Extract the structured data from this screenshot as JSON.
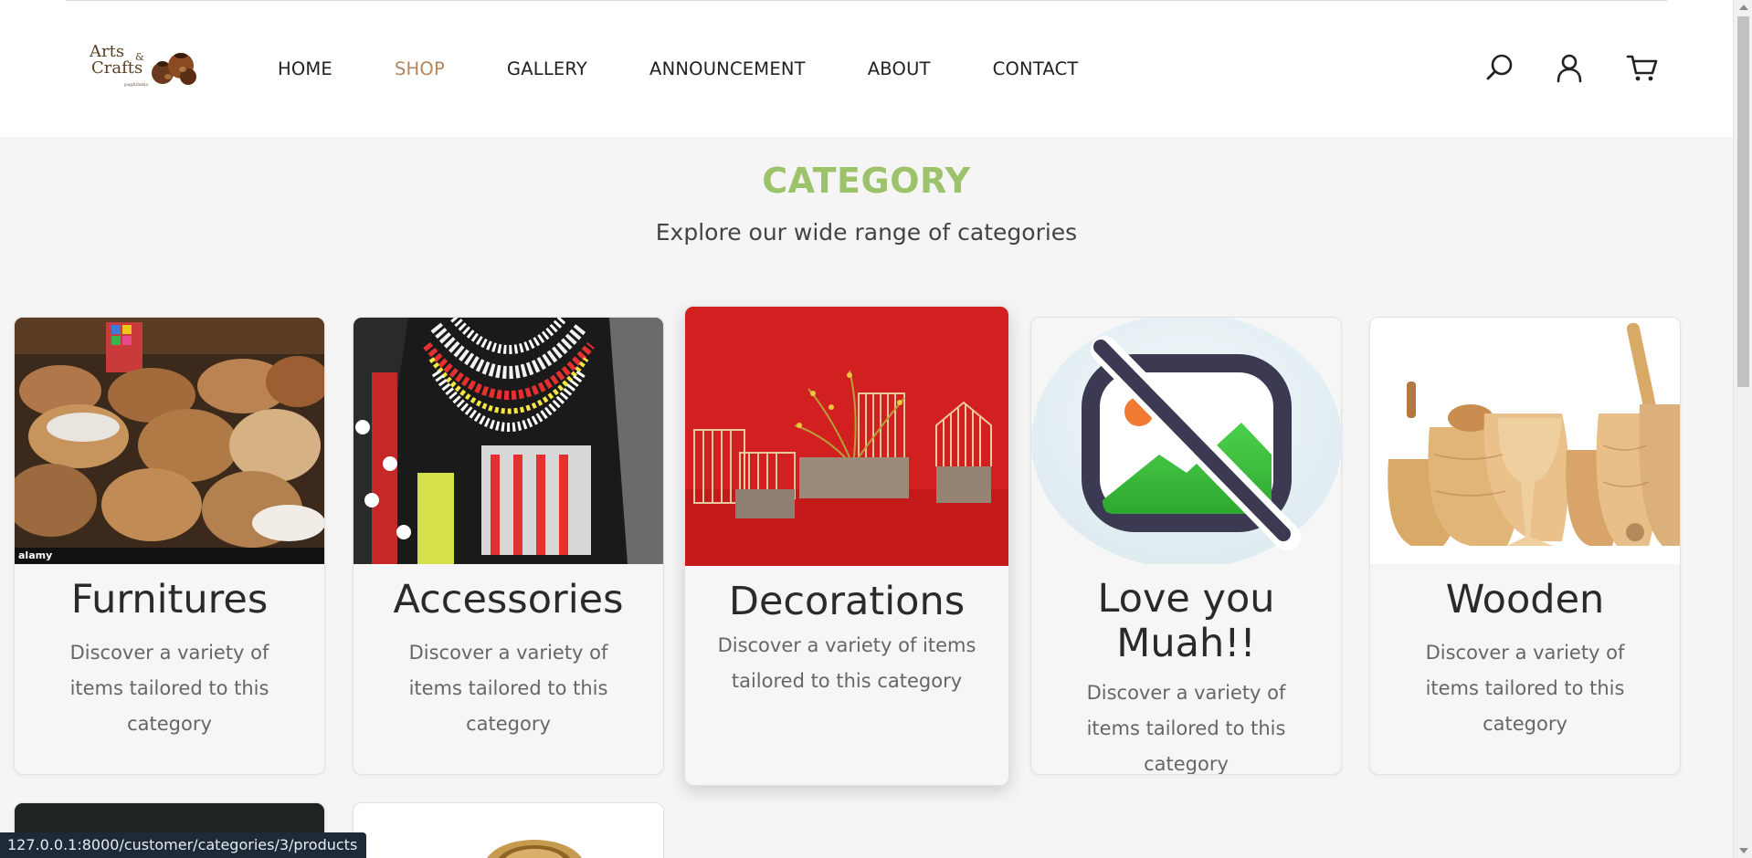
{
  "header": {
    "logo": {
      "line1": "Arts",
      "amp": "&",
      "line2": "Crafts",
      "sub": "paghilamo"
    },
    "nav": [
      {
        "label": "HOME",
        "active": false
      },
      {
        "label": "SHOP",
        "active": true
      },
      {
        "label": "GALLERY",
        "active": false
      },
      {
        "label": "ANNOUNCEMENT",
        "active": false
      },
      {
        "label": "ABOUT",
        "active": false
      },
      {
        "label": "CONTACT",
        "active": false
      }
    ],
    "icons": [
      "search-icon",
      "user-icon",
      "cart-icon"
    ],
    "accent_color": "#b5865b"
  },
  "main": {
    "title": "CATEGORY",
    "subtitle": "Explore our wide range of categories",
    "title_color": "#9dc26c",
    "categories": [
      {
        "name": "Furnitures",
        "description": "Discover a variety of items tailored to this category",
        "image": "wicker-baskets",
        "watermark": "alamy"
      },
      {
        "name": "Accessories",
        "description": "Discover a variety of items tailored to this category",
        "image": "beaded-necklace"
      },
      {
        "name": "Decorations",
        "description": "Discover a variety of items tailored to this category",
        "image": "rattan-decor-on-red",
        "hovered": true
      },
      {
        "name": "Love you Muah!!",
        "description": "Discover a variety of items tailored to this category",
        "image": "no-image-placeholder"
      },
      {
        "name": "Wooden",
        "description": "Discover a variety of items tailored to this category",
        "image": "wooden-cups"
      }
    ]
  },
  "status_bar": {
    "url": "127.0.0.1:8000/customer/categories/3/products"
  }
}
